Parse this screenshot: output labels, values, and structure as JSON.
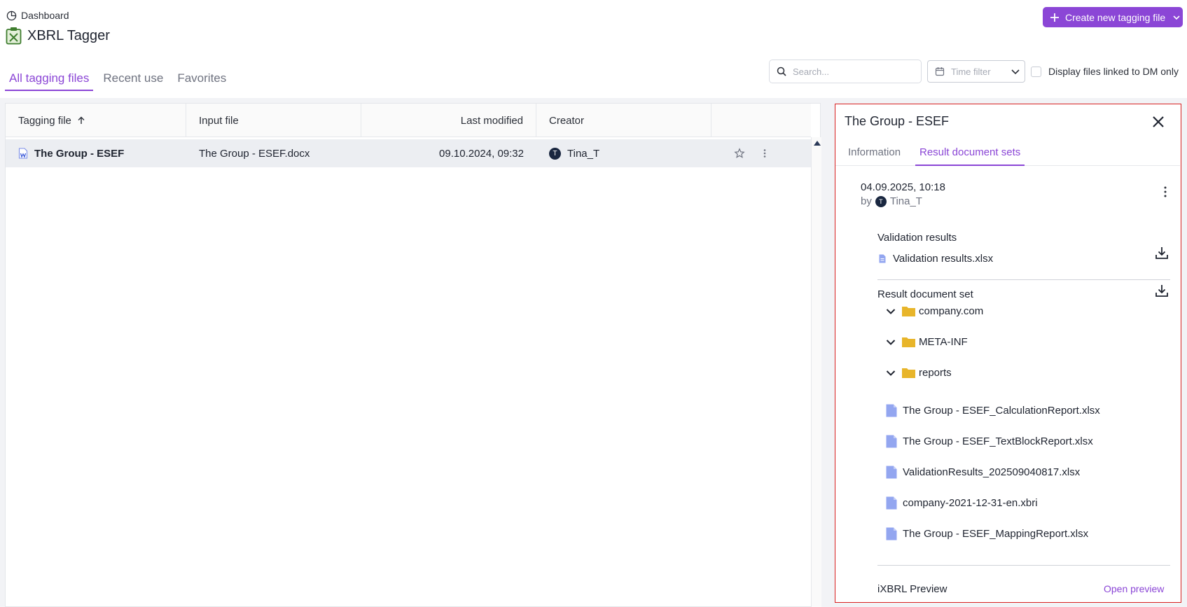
{
  "breadcrumb": {
    "label": "Dashboard"
  },
  "app": {
    "title": "XBRL Tagger"
  },
  "actions": {
    "create_label": "Create new tagging file"
  },
  "tabs": [
    {
      "label": "All tagging files",
      "active": true
    },
    {
      "label": "Recent use",
      "active": false
    },
    {
      "label": "Favorites",
      "active": false
    }
  ],
  "filters": {
    "search_placeholder": "Search...",
    "time_filter_label": "Time filter",
    "dm_only_label": "Display files linked to DM only",
    "dm_only_checked": false
  },
  "table": {
    "columns": [
      "Tagging file",
      "Input file",
      "Last modified",
      "Creator"
    ],
    "sort_column": "Tagging file",
    "sort_direction": "ascending",
    "rows": [
      {
        "tagging_file": "The Group - ESEF",
        "input_file": "The Group - ESEF.docx",
        "last_modified": "09.10.2024, 09:32",
        "creator": "Tina_T",
        "creator_initial": "T"
      }
    ]
  },
  "panel": {
    "title": "The Group - ESEF",
    "tabs": [
      {
        "label": "Information",
        "active": false
      },
      {
        "label": "Result document sets",
        "active": true
      }
    ],
    "result_set": {
      "date": "04.09.2025, 10:18",
      "by_label": "by",
      "author": "Tina_T",
      "author_initial": "T"
    },
    "validation": {
      "title": "Validation results",
      "file": "Validation results.xlsx"
    },
    "document_set": {
      "title": "Result document set",
      "folders": [
        "company.com",
        "META-INF",
        "reports"
      ],
      "files": [
        "The Group - ESEF_CalculationReport.xlsx",
        "The Group - ESEF_TextBlockReport.xlsx",
        "ValidationResults_202509040817.xlsx",
        "company-2021-12-31-en.xbri",
        "The Group - ESEF_MappingReport.xlsx"
      ]
    },
    "preview": {
      "title": "iXBRL Preview",
      "link": "Open preview"
    }
  },
  "colors": {
    "accent": "#8b46d6",
    "panel_border": "#d81f1f",
    "folder": "#e8b52a",
    "file": "#93a6f0"
  }
}
